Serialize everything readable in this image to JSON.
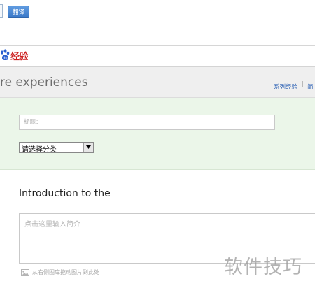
{
  "toolbar": {
    "translate_label": "翻译"
  },
  "brand": {
    "logo_text": "经验"
  },
  "header": {
    "title": "re experiences",
    "link_series": "系列经验",
    "separator": "|",
    "link_simple": "简"
  },
  "form": {
    "title_placeholder": "标题：",
    "category_selected": "请选择分类"
  },
  "intro": {
    "heading": "Introduction to the",
    "textarea_placeholder": "点击这里输入简介",
    "upload_hint": "从右侧图库拖动图片到此处"
  },
  "watermark": {
    "text": "软件技巧"
  }
}
